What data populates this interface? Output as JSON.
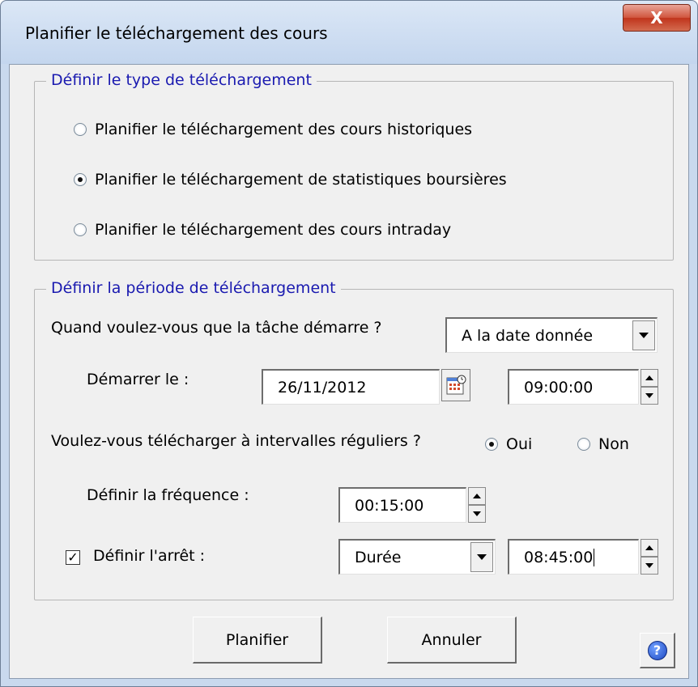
{
  "window": {
    "title": "Planifier le téléchargement des cours",
    "close_label": "X"
  },
  "type_group": {
    "legend": "Définir le type de téléchargement",
    "options": [
      {
        "label": "Planifier le téléchargement des cours historiques",
        "selected": false
      },
      {
        "label": "Planifier le téléchargement de statistiques boursières",
        "selected": true
      },
      {
        "label": "Planifier le téléchargement des cours intraday",
        "selected": false
      }
    ]
  },
  "period_group": {
    "legend": "Définir la période de téléchargement",
    "start_question": "Quand voulez-vous que la tâche démarre ?",
    "start_mode_value": "A la date donnée",
    "start_label": "Démarrer le :",
    "start_date": "26/11/2012",
    "start_time": "09:00:00",
    "interval_question": "Voulez-vous télécharger à intervalles réguliers ?",
    "interval_yes": "Oui",
    "interval_no": "Non",
    "interval_selected": "Oui",
    "frequency_label": "Définir la fréquence :",
    "frequency_value": "00:15:00",
    "stop_label": "Définir l'arrêt :",
    "stop_checked": true,
    "stop_mode_value": "Durée",
    "stop_time": "08:45:00"
  },
  "buttons": {
    "schedule": "Planifier",
    "cancel": "Annuler",
    "help_icon": "help-icon"
  }
}
